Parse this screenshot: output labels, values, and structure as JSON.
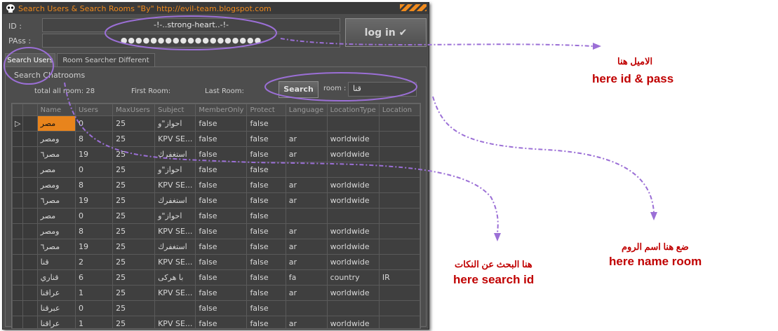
{
  "window": {
    "title": "Search Users & Search Rooms     \"By\"  http://evil-team.blogspot.com"
  },
  "login": {
    "id_label": "ID :",
    "pass_label": "PAss :",
    "id_value": "-!-..strong-heart..-!-",
    "pass_value": "●●●●●●●●●●●●●●●●●●●",
    "login_button": "log in ✔"
  },
  "tabs": [
    {
      "label": "Search Users"
    },
    {
      "label": "Room Searcher Different"
    }
  ],
  "search": {
    "group_label": "Search Chatrooms",
    "total_label": "total all room: 28",
    "first_label": "First Room:",
    "last_label": "Last Room:",
    "search_button": "Search",
    "room_label": "room :",
    "room_value": "قنا"
  },
  "table": {
    "columns": [
      "Name",
      "Users",
      "MaxUsers",
      "Subject",
      "MemberOnly",
      "Protect",
      "Language",
      "LocationType",
      "Location"
    ],
    "rows": [
      [
        "مصر",
        "0",
        "25",
        "احواز\"و",
        "false",
        "false",
        "",
        "",
        ""
      ],
      [
        "ومصر",
        "8",
        "25",
        "KPV SE...",
        "false",
        "false",
        "ar",
        "worldwide",
        ""
      ],
      [
        "مصر٦",
        "19",
        "25",
        "استغفرك",
        "false",
        "false",
        "ar",
        "worldwide",
        ""
      ],
      [
        "مصر",
        "0",
        "25",
        "احواز\"و",
        "false",
        "false",
        "",
        "",
        ""
      ],
      [
        "ومصر",
        "8",
        "25",
        "KPV SE...",
        "false",
        "false",
        "ar",
        "worldwide",
        ""
      ],
      [
        "مصر٦",
        "19",
        "25",
        "استغفرك",
        "false",
        "false",
        "ar",
        "worldwide",
        ""
      ],
      [
        "مصر",
        "0",
        "25",
        "احواز\"و",
        "false",
        "false",
        "",
        "",
        ""
      ],
      [
        "ومصر",
        "8",
        "25",
        "KPV SE...",
        "false",
        "false",
        "ar",
        "worldwide",
        ""
      ],
      [
        "مصر٦",
        "19",
        "25",
        "استغفرك",
        "false",
        "false",
        "ar",
        "worldwide",
        ""
      ],
      [
        "قنا",
        "2",
        "25",
        "KPV SE...",
        "false",
        "false",
        "ar",
        "worldwide",
        ""
      ],
      [
        "قناري",
        "6",
        "25",
        "با هركى",
        "false",
        "false",
        "fa",
        "country",
        "IR"
      ],
      [
        "عراقنا",
        "1",
        "25",
        "KPV SE...",
        "false",
        "false",
        "ar",
        "worldwide",
        ""
      ],
      [
        "عبرقنا",
        "0",
        "25",
        "",
        "false",
        "false",
        "",
        "",
        ""
      ],
      [
        "عراقنا",
        "1",
        "25",
        "KPV SE...",
        "false",
        "false",
        "ar",
        "worldwide",
        ""
      ]
    ],
    "selected_row_marker": "▷"
  },
  "annotations": {
    "id_pass_ar": "الاميل هنا",
    "id_pass_en": "here id & pass",
    "search_id_ar": "هنا البحث عن النكات",
    "search_id_en": "here search id",
    "room_ar": "ضع هنا اسم الروم",
    "room_en": "here name room"
  },
  "colors": {
    "accent": "#f08a1c",
    "highlight_circle": "#9b6fd6",
    "annotation_text": "#c00000"
  }
}
